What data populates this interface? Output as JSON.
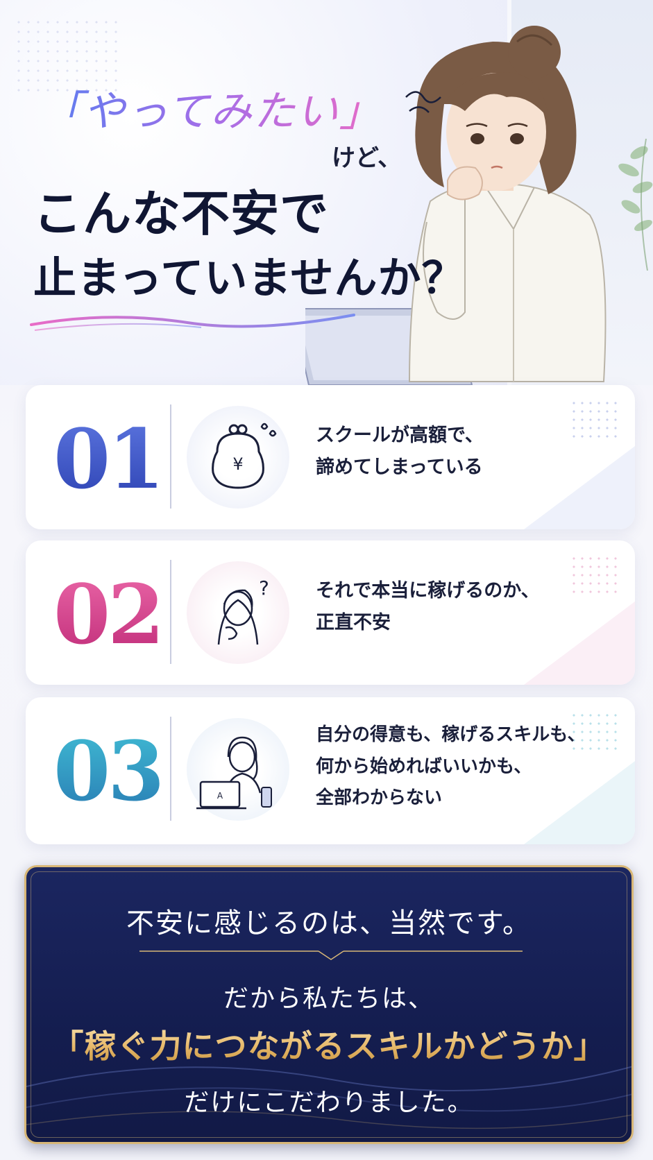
{
  "hero": {
    "line1": "「やってみたい」",
    "line1_suffix": "けど、",
    "line2": "こんな不安で",
    "line3": "止まっていませんか？"
  },
  "worries": [
    {
      "number": "01",
      "text_lines": [
        "スクールが高額で、",
        "諦めてしまっている"
      ],
      "icon": "coin-purse-yen-icon",
      "color": "#4057c8"
    },
    {
      "number": "02",
      "text_lines": [
        "それで本当に稼げるのか、",
        "正直不安"
      ],
      "icon": "worried-woman-icon",
      "color": "#d9428f"
    },
    {
      "number": "03",
      "text_lines": [
        "自分の得意も、稼げるスキルも、",
        "何から始めればいいかも、",
        "全部わからない"
      ],
      "icon": "woman-laptop-icon",
      "color": "#2aa3c2"
    }
  ],
  "cta": {
    "line1": "不安に感じるのは、当然です。",
    "line2": "だから私たちは、",
    "line3": "「稼ぐ力につながるスキルかどうか」",
    "line4": "だけにこだわりました。"
  },
  "colors": {
    "navy": "#141d4f",
    "gold": "#d8b777",
    "pink_accent": "#e86bc6",
    "blue_accent": "#5a7ef0"
  }
}
